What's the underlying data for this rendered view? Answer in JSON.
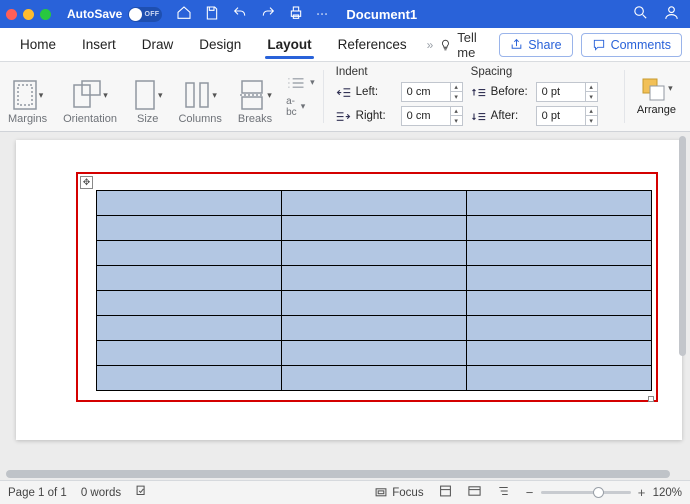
{
  "titlebar": {
    "autosave_label": "AutoSave",
    "autosave_state": "OFF",
    "doc_title": "Document1",
    "overflow": "···"
  },
  "tabs": {
    "items": [
      "Home",
      "Insert",
      "Draw",
      "Design",
      "Layout",
      "References"
    ],
    "active_index": 4,
    "chevrons": "»",
    "tell_me": "Tell me",
    "share": "Share",
    "comments": "Comments"
  },
  "ribbon": {
    "margins": "Margins",
    "orientation": "Orientation",
    "size": "Size",
    "columns": "Columns",
    "breaks": "Breaks",
    "line_numbers_glyph": "1\n2\n3",
    "hyphen_glyph": "bc",
    "indent_title": "Indent",
    "indent_left_label": "Left:",
    "indent_left_value": "0 cm",
    "indent_right_label": "Right:",
    "indent_right_value": "0 cm",
    "spacing_title": "Spacing",
    "spacing_before_label": "Before:",
    "spacing_before_value": "0 pt",
    "spacing_after_label": "After:",
    "spacing_after_value": "0 pt",
    "arrange": "Arrange"
  },
  "document": {
    "table": {
      "rows": 8,
      "cols": 3,
      "cell_fill": "#b3c7e3"
    },
    "annotation_border_color": "#d40000"
  },
  "status": {
    "page": "Page 1 of 1",
    "words": "0 words",
    "focus": "Focus",
    "zoom_minus": "−",
    "zoom_plus": "+",
    "zoom_value": "120%"
  }
}
